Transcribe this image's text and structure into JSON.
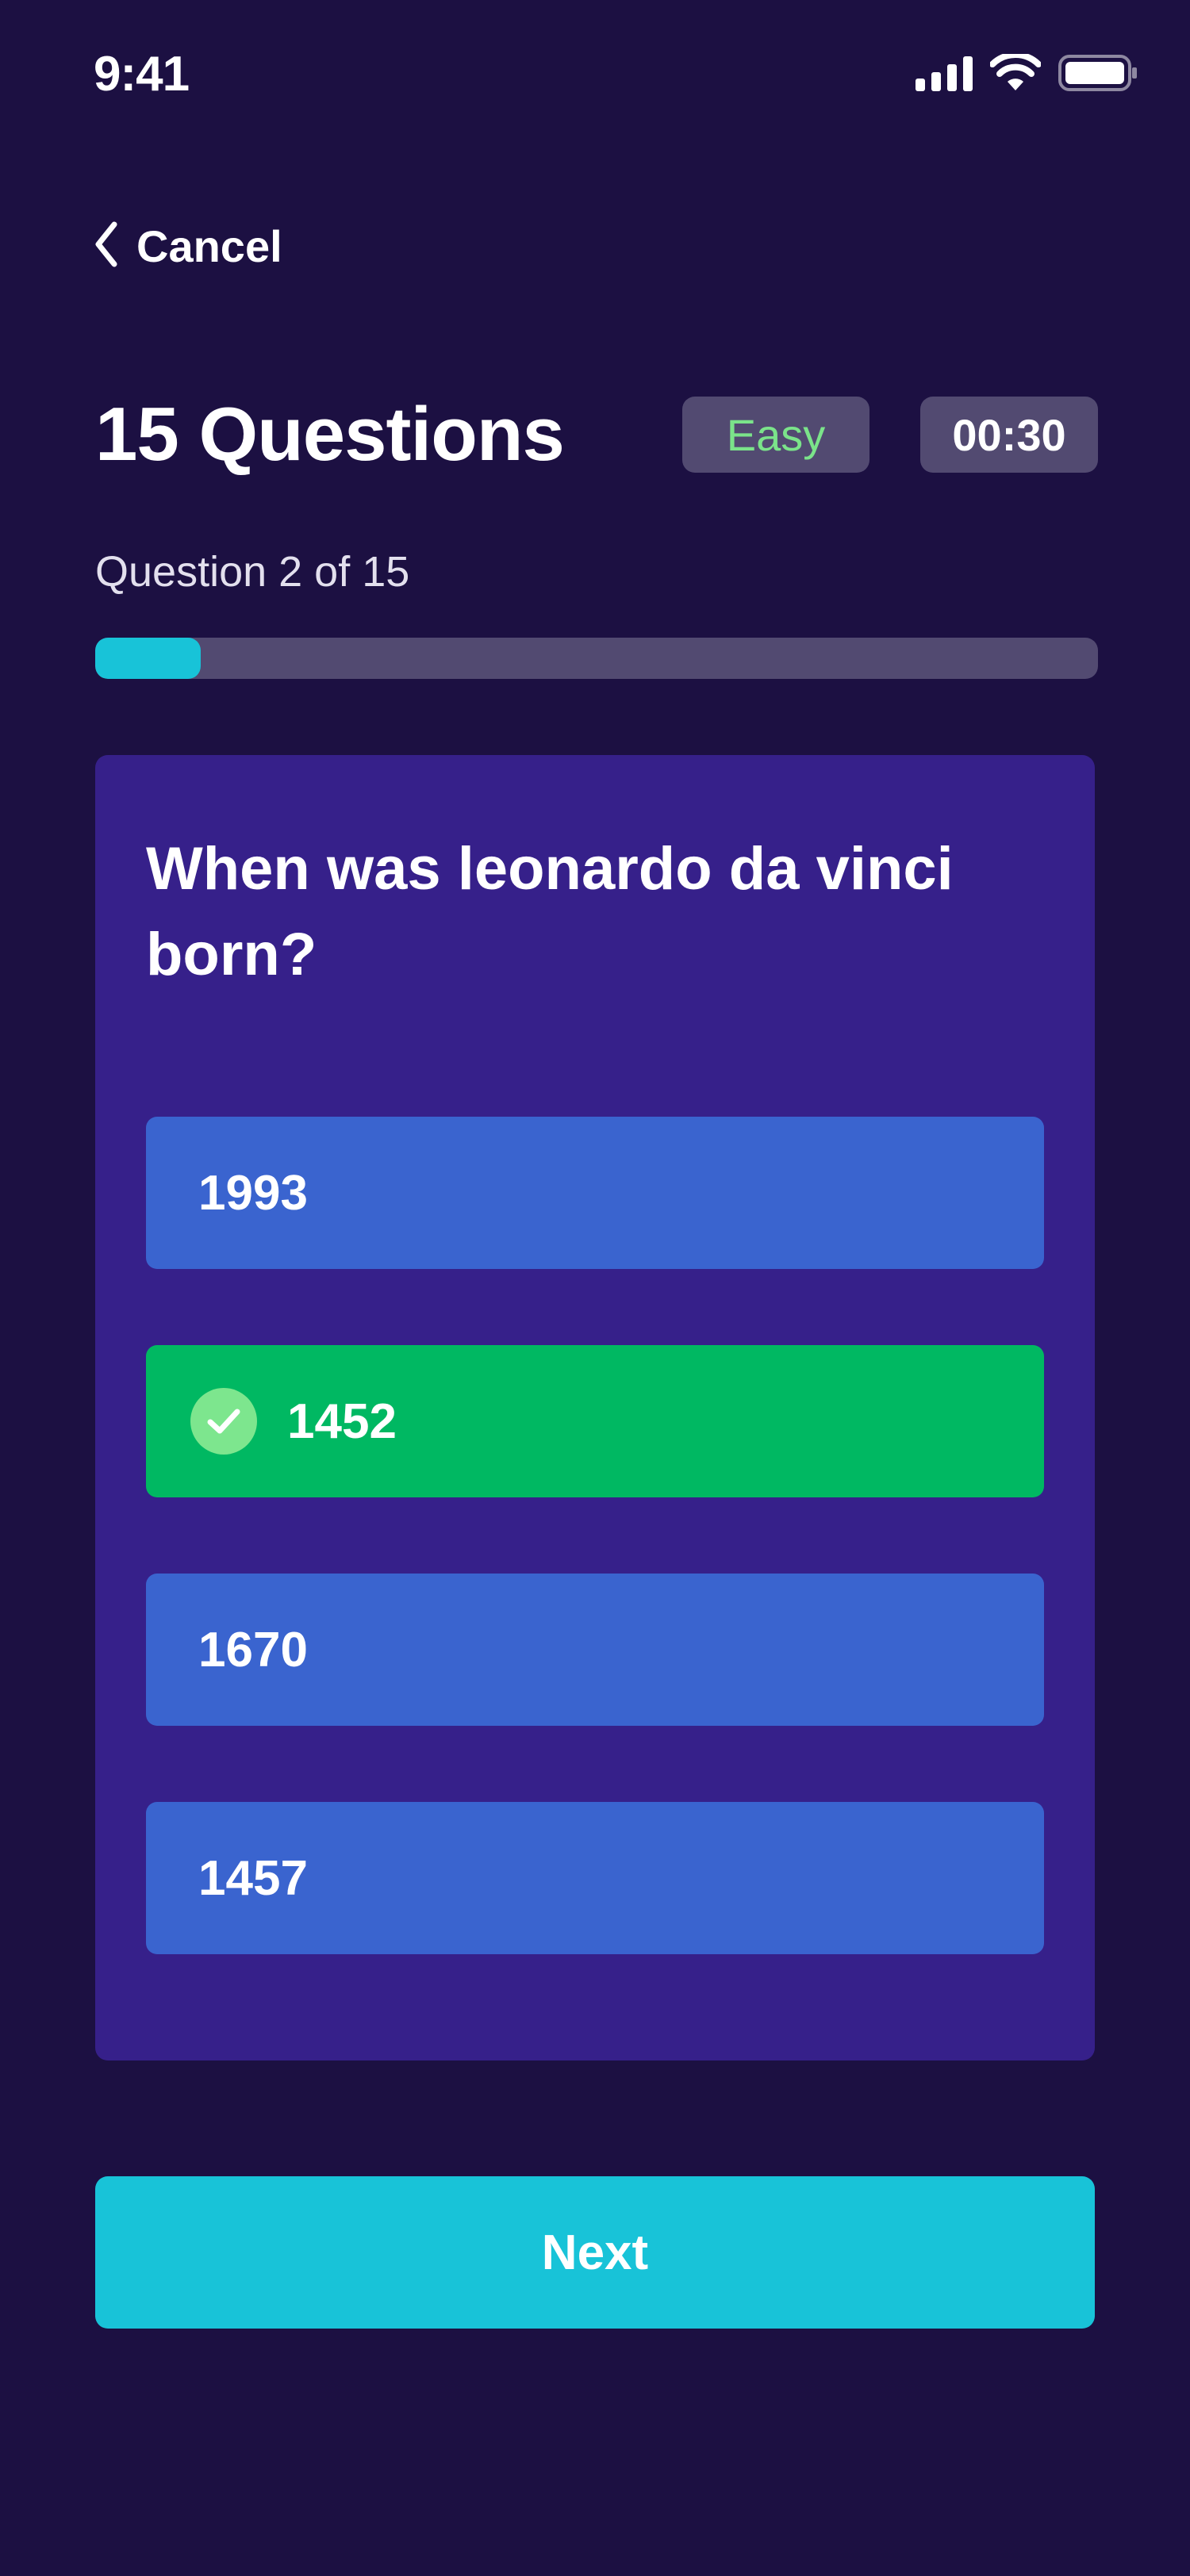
{
  "status_bar": {
    "time": "9:41",
    "icons": [
      "cellular-signal-icon",
      "wifi-icon",
      "battery-icon"
    ]
  },
  "nav": {
    "cancel_label": "Cancel",
    "icon": "chevron-left-icon"
  },
  "header": {
    "title": "15 Questions",
    "difficulty": "Easy",
    "timer": "00:30"
  },
  "progress": {
    "label": "Question 2 of 15",
    "current": 2,
    "total": 15,
    "fraction": 0.105
  },
  "question": {
    "text": "When was leonardo da vinci born?",
    "answers": [
      {
        "label": "1993",
        "state": "default"
      },
      {
        "label": "1452",
        "state": "correct",
        "icon": "checkmark-icon"
      },
      {
        "label": "1670",
        "state": "default"
      },
      {
        "label": "1457",
        "state": "default"
      }
    ]
  },
  "actions": {
    "next_label": "Next"
  },
  "colors": {
    "background": "#1c1042",
    "card": "#36208a",
    "answer": "#3a64cf",
    "correct": "#00b862",
    "accent": "#18c3d8",
    "pill": "#524a71",
    "easy_text": "#7be38a"
  }
}
